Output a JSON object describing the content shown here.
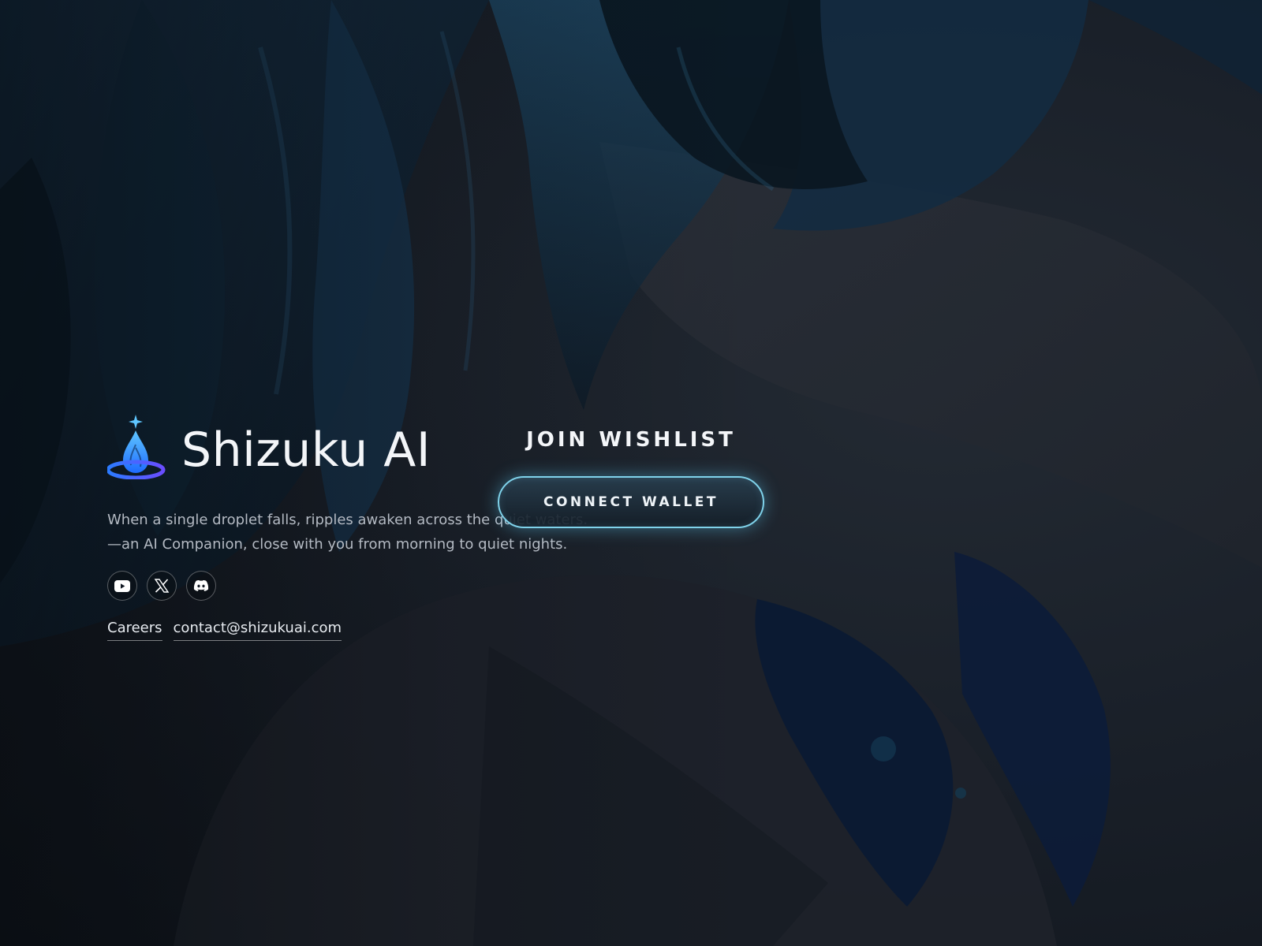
{
  "brand": {
    "name": "Shizuku AI",
    "logo_icon": "water-droplet-logo",
    "accent_color": "#3aa3ff"
  },
  "tagline": {
    "line1": "When a single droplet falls, ripples awaken across the quiet waters.",
    "line2": "—an AI Companion, close with you from morning to quiet nights."
  },
  "socials": [
    {
      "icon": "youtube-icon"
    },
    {
      "icon": "x-icon"
    },
    {
      "icon": "discord-icon"
    }
  ],
  "links": {
    "careers": "Careers",
    "contact": "contact@shizukuai.com"
  },
  "wishlist": {
    "title": "JOIN WISHLIST",
    "button_label": "CONNECT WALLET",
    "button_glow_color": "#7fd2ea"
  },
  "colors": {
    "background": "#151a22",
    "text_primary": "#f3f5f8",
    "text_secondary": "#b4bac3"
  }
}
